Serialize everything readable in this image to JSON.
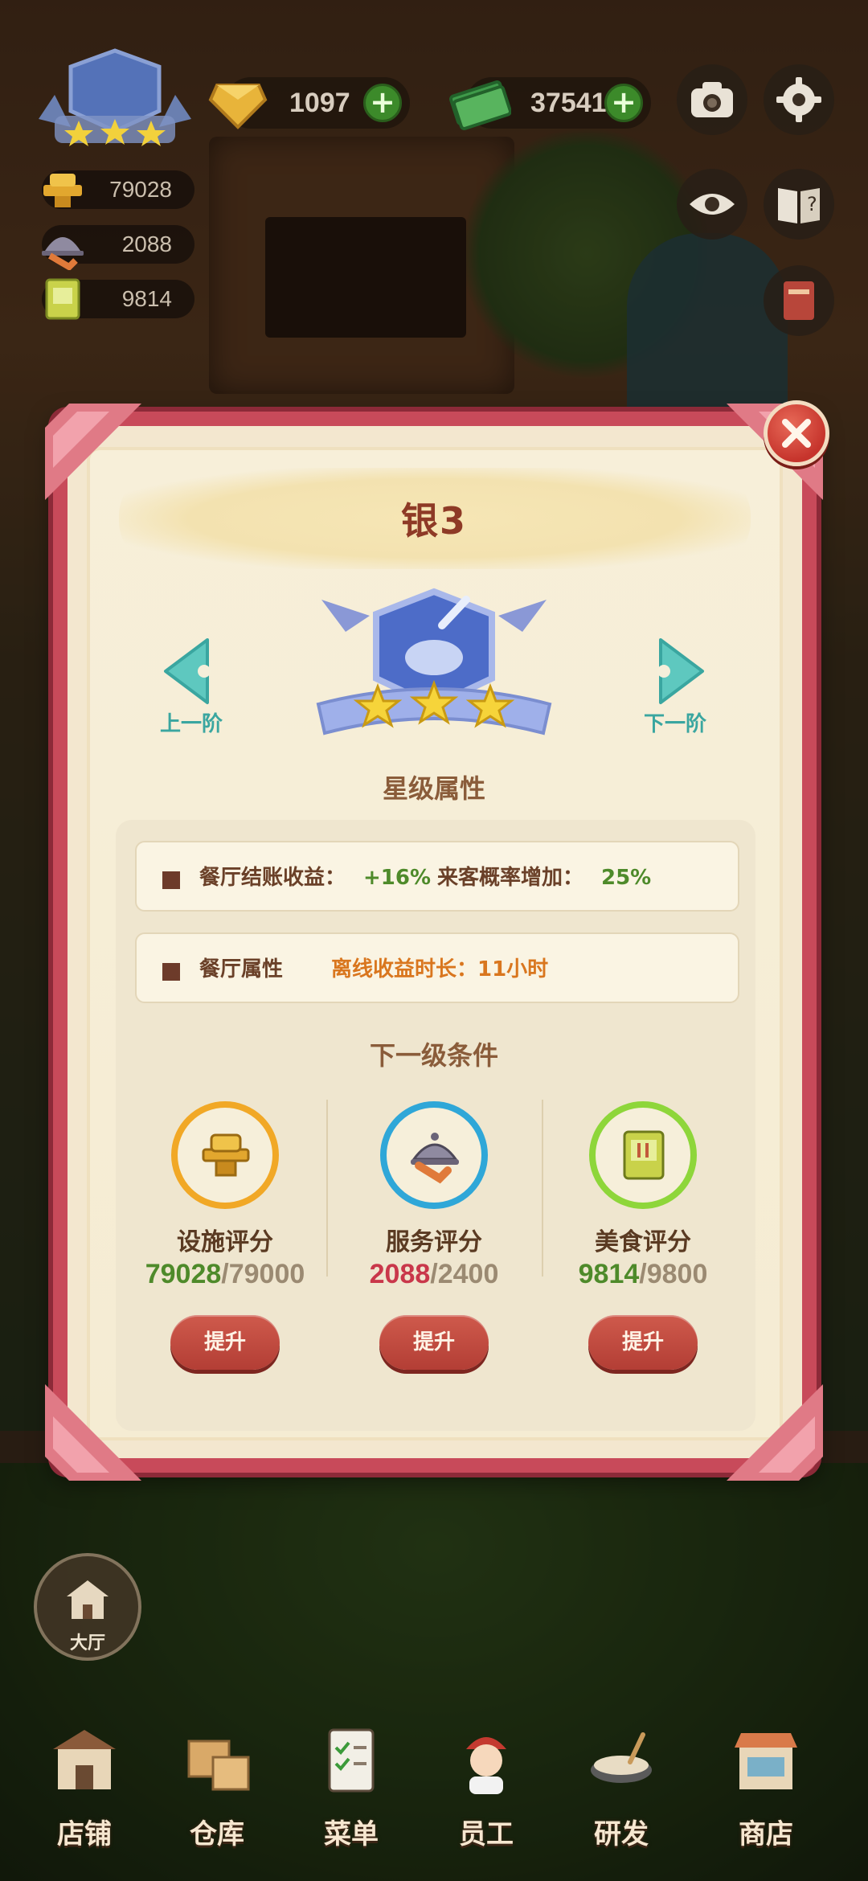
{
  "hud": {
    "gems": "1097",
    "cash": "375416",
    "plus_symbol": "+",
    "facility_score": "79028",
    "service_score": "2088",
    "food_score": "9814"
  },
  "modal": {
    "title": "银3",
    "prev_label": "上一阶",
    "next_label": "下一阶",
    "star_section_title": "星级属性",
    "attributes": [
      {
        "label": "餐厅结账收益：",
        "value": "+16%",
        "label2": "来客概率增加：",
        "value2": "25%"
      },
      {
        "label": "餐厅属性",
        "value": "离线收益时长：11小时"
      }
    ],
    "next_section_title": "下一级条件",
    "conditions": [
      {
        "name": "设施评分",
        "current": "79028",
        "target": "/79000",
        "current_color": "#4e8a2a",
        "button": "提升"
      },
      {
        "name": "服务评分",
        "current": "2088",
        "target": "/2400",
        "current_color": "#c9374a",
        "button": "提升"
      },
      {
        "name": "美食评分",
        "current": "9814",
        "target": "/9800",
        "current_color": "#4e8a2a",
        "button": "提升"
      }
    ],
    "colors": {
      "frame": "#c84a5a",
      "accent_green": "#4e8a2a",
      "accent_red": "#c9374a",
      "offline_orange": "#d9761e",
      "teal": "#3aa6a0"
    }
  },
  "hall_label": "大厅",
  "tabs": [
    {
      "label": "店铺",
      "icon": "shop-building-icon"
    },
    {
      "label": "仓库",
      "icon": "warehouse-boxes-icon"
    },
    {
      "label": "菜单",
      "icon": "menu-clipboard-icon"
    },
    {
      "label": "员工",
      "icon": "staff-chef-icon"
    },
    {
      "label": "研发",
      "icon": "research-pot-icon"
    },
    {
      "label": "商店",
      "icon": "store-stall-icon"
    }
  ]
}
